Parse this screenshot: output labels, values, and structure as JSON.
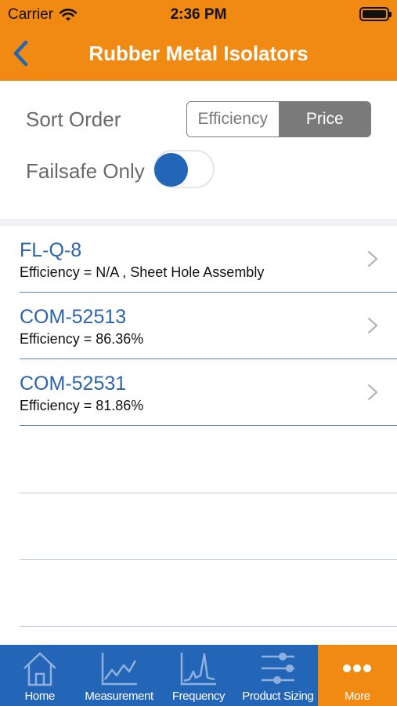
{
  "status_bar": {
    "carrier": "Carrier",
    "time": "2:36 PM"
  },
  "nav": {
    "title": "Rubber Metal Isolators"
  },
  "sort": {
    "label": "Sort Order",
    "options": [
      "Efficiency",
      "Price"
    ],
    "selected": "Price"
  },
  "failsafe": {
    "label": "Failsafe Only",
    "enabled": false
  },
  "results": [
    {
      "name": "FL-Q-8",
      "detail": "Efficiency = N/A , Sheet Hole Assembly"
    },
    {
      "name": "COM-52513",
      "detail": "Efficiency = 86.36%"
    },
    {
      "name": "COM-52531",
      "detail": "Efficiency = 81.86%"
    }
  ],
  "tabs": [
    {
      "label": "Home",
      "icon": "home-icon"
    },
    {
      "label": "Measurement",
      "icon": "line-chart-icon"
    },
    {
      "label": "Frequency",
      "icon": "frequency-chart-icon"
    },
    {
      "label": "Product Sizing",
      "icon": "sliders-icon"
    },
    {
      "label": "More",
      "icon": "more-dots-icon",
      "active": true
    }
  ],
  "colors": {
    "header": "#f08a12",
    "tabbar": "#2365b6",
    "link_blue": "#2c63ad",
    "toggle_knob": "#2365b6"
  }
}
